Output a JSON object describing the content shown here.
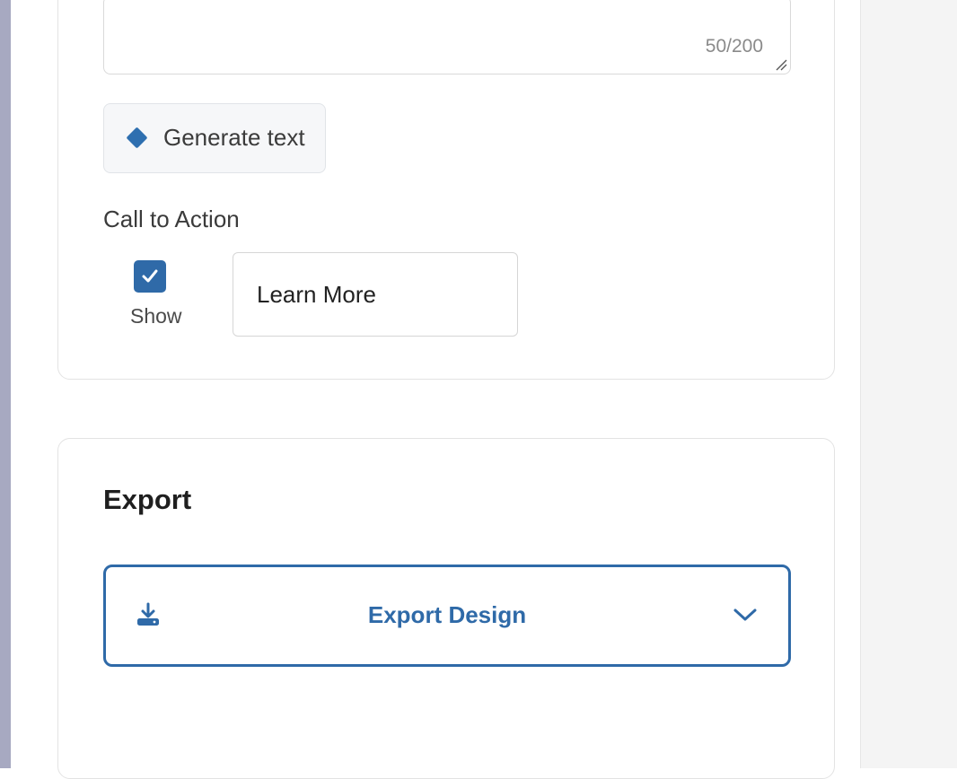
{
  "description": {
    "char_count": "50/200"
  },
  "generate": {
    "label": "Generate text",
    "icon": "diamond-icon"
  },
  "call_to_action": {
    "label": "Call to Action",
    "show_label": "Show",
    "show_checked": true,
    "input_value": "Learn More"
  },
  "export": {
    "title": "Export",
    "button_label": "Export Design",
    "button_icon": "download-icon",
    "dropdown_icon": "chevron-down-icon"
  },
  "colors": {
    "accent": "#2f6aa8",
    "left_bar": "#a7a9c1",
    "right_rail": "#f4f4f4"
  }
}
